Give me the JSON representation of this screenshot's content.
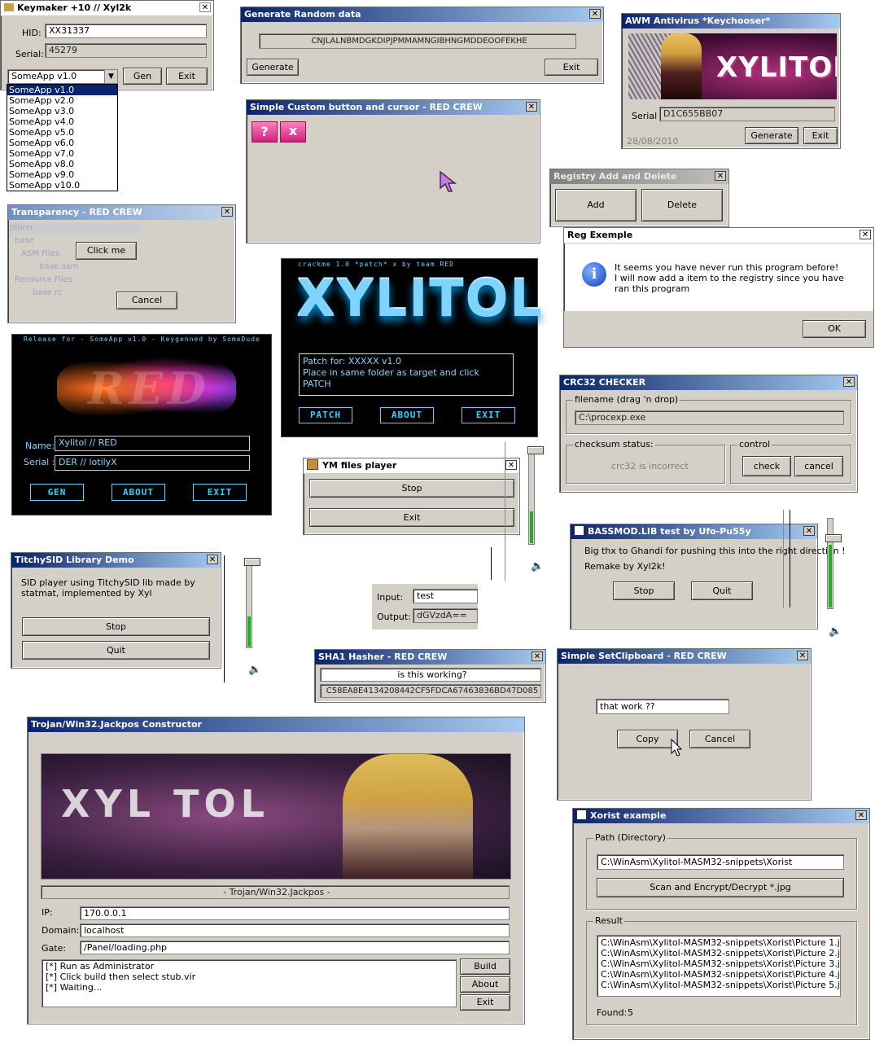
{
  "keymaker": {
    "title": "Keymaker +10 // Xyl2k",
    "close": "✕",
    "hid_label": "HID:",
    "hid_value": "XX31337",
    "serial_label": "Serial:",
    "serial_value": "45279",
    "combo_value": "SomeApp v1.0",
    "gen_button": "Gen",
    "exit_button": "Exit",
    "options": [
      "SomeApp v1.0",
      "SomeApp v2.0",
      "SomeApp v3.0",
      "SomeApp v4.0",
      "SomeApp v5.0",
      "SomeApp v6.0",
      "SomeApp v7.0",
      "SomeApp v8.0",
      "SomeApp v9.0",
      "SomeApp v10.0"
    ]
  },
  "random": {
    "title": "Generate Random data",
    "value": "CNJLALNBMDGKDIPJPMMAMNGIBHNGMDDEOOFEKHE",
    "generate_button": "Generate",
    "exit_button": "Exit"
  },
  "awm": {
    "title": "AWM Antivirus *Keychooser*",
    "banner_text": "XYLITOL",
    "serial_label": "Serial",
    "serial_value": "D1C655BB07",
    "date": "28/08/2010",
    "generate_button": "Generate",
    "exit_button": "Exit"
  },
  "custom_button": {
    "title": "Simple Custom button and cursor - RED CREW",
    "btn1": "?",
    "btn2": "x"
  },
  "registry": {
    "title": "Registry Add and Delete",
    "add_button": "Add",
    "delete_button": "Delete"
  },
  "transparency": {
    "title": "Transparency - RED CREW",
    "ghost_title": "plorer",
    "tree": [
      "base",
      "ASM Files",
      "base.asm",
      "Resource Files",
      "base.rc"
    ],
    "click_button": "Click me",
    "cancel_button": "Cancel"
  },
  "reg_example": {
    "title": "Reg Exemple",
    "message": "It seems you have never run this program before!\nI will now add a item to the registry since you have ran this program",
    "ok_button": "OK"
  },
  "crackme": {
    "scroll_text": "crackme 1.0 *patch* x by team RED",
    "logo": "XYLITOL",
    "patch_text": "Patch for: XXXXX v1.0\nPlace in same folder as target and click PATCH",
    "buttons": [
      "PATCH",
      "ABOUT",
      "EXIT"
    ]
  },
  "release": {
    "scroll_text": "Release for - SomeApp v1.0 - Keygenned by SomeDude",
    "logo": "RED",
    "name_label": "Name:",
    "name_value": "Xylitol // RED",
    "serial_label": "Serial :",
    "serial_value": "DER // lotilyX",
    "buttons": [
      "GEN",
      "ABOUT",
      "EXIT"
    ]
  },
  "crc": {
    "title": "CRC32 CHECKER",
    "filename_group": "filename (drag 'n drop)",
    "filename_value": "C:\\procexp.exe",
    "status_group": "checksum status:",
    "status_value": "crc32 is incorrect",
    "control_group": "control",
    "check_button": "check",
    "cancel_button": "cancel"
  },
  "ym": {
    "title": "YM files player",
    "stop_button": "Stop",
    "exit_button": "Exit"
  },
  "bassmod": {
    "title": "BASSMOD.LIB test by Ufo-Pu55y",
    "line1": "Big thx to Ghandi for pushing this into the right direction !",
    "line2": "Remake by Xyl2k!",
    "stop_button": "Stop",
    "quit_button": "Quit"
  },
  "titchy": {
    "title": "TitchySID Library Demo",
    "text": "SID player using TitchySID lib made by statmat, implemented by Xyl",
    "stop_button": "Stop",
    "quit_button": "Quit"
  },
  "base64": {
    "input_label": "Input:",
    "input_value": "test",
    "output_label": "Output:",
    "output_value": "dGVzdA=="
  },
  "sha1": {
    "title": "SHA1 Hasher - RED CREW",
    "input_value": "is this working?",
    "hash_value": "C58EA8E4134208442CF5FDCA67463836BD47D085"
  },
  "clipboard": {
    "title": "Simple SetClipboard - RED CREW",
    "input_value": "that work ??",
    "copy_button": "Copy",
    "cancel_button": "Cancel"
  },
  "trojan": {
    "title": "Trojan/Win32.Jackpos Constructor",
    "banner_text": "XYL TOL",
    "status": "- Trojan/Win32.Jackpos -",
    "ip_label": "IP:",
    "ip_value": "170.0.0.1",
    "domain_label": "Domain:",
    "domain_value": "localhost",
    "gate_label": "Gate:",
    "gate_value": "/Panel/loading.php",
    "log": "[*] Run as Administrator\n[*] Click build then select stub.vir\n[*] Waiting...",
    "build_button": "Build",
    "about_button": "About",
    "exit_button": "Exit"
  },
  "xorist": {
    "title": "Xorist example",
    "path_group": "Path (Directory)",
    "path_value": "C:\\WinAsm\\Xylitol-MASM32-snippets\\Xorist",
    "scan_button": "Scan and Encrypt/Decrypt *.jpg",
    "result_group": "Result",
    "results": [
      "C:\\WinAsm\\Xylitol-MASM32-snippets\\Xorist\\Picture 1.jpg",
      "C:\\WinAsm\\Xylitol-MASM32-snippets\\Xorist\\Picture 2.jpg",
      "C:\\WinAsm\\Xylitol-MASM32-snippets\\Xorist\\Picture 3.jpg",
      "C:\\WinAsm\\Xylitol-MASM32-snippets\\Xorist\\Picture 4.jpg",
      "C:\\WinAsm\\Xylitol-MASM32-snippets\\Xorist\\Picture 5.jpg"
    ],
    "found_label": "Found:",
    "found_value": "5"
  },
  "volumes": [
    {
      "level": 0.35
    },
    {
      "level": 0.7
    },
    {
      "level": 0.35
    },
    {
      "level": 0.3
    }
  ],
  "icons": {
    "speaker": "speaker-icon",
    "info": "info-icon",
    "cursor": "cursor-icon"
  }
}
